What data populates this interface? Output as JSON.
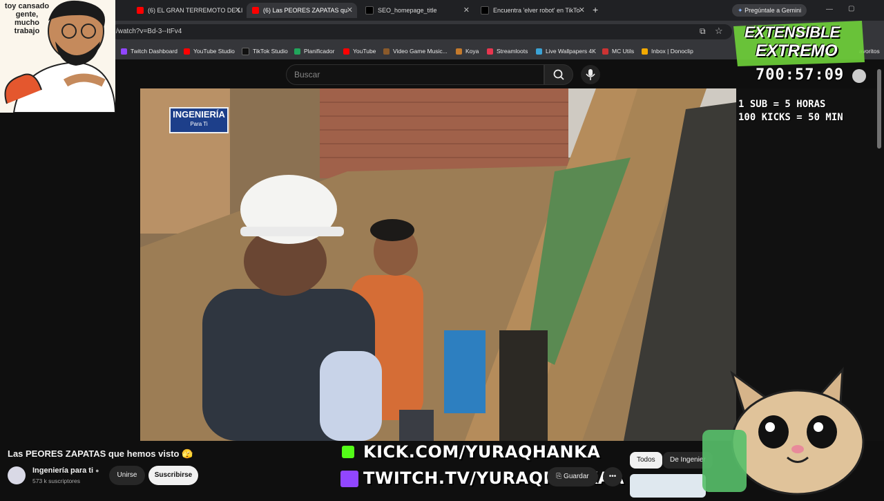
{
  "browser": {
    "tabs": [
      {
        "label": "(6) EL GRAN TERREMOTO DE LI",
        "favicon_color": "#ff0000"
      },
      {
        "label": "(6) Las PEORES ZAPATAS qu",
        "favicon_color": "#ff0000",
        "active": true
      },
      {
        "label": "SEO_homepage_title",
        "favicon_color": "#000000"
      },
      {
        "label": "Encuentra 'elver robot' en TikTo",
        "favicon_color": "#000000"
      }
    ],
    "new_tab": "+",
    "gemini_button": "Pregúntale a Gemini",
    "url": "/watch?v=Bd-3--ItFv4",
    "bookmarks": [
      {
        "label": "Twitch Dashboard",
        "color": "#9146ff"
      },
      {
        "label": "YouTube Studio",
        "color": "#ff0000"
      },
      {
        "label": "TikTok Studio",
        "color": "#111111"
      },
      {
        "label": "Planificador",
        "color": "#21a65b"
      },
      {
        "label": "YouTube",
        "color": "#ff0000"
      },
      {
        "label": "Video Game Music...",
        "color": "#8a5a2b"
      },
      {
        "label": "Koya",
        "color": "#c47a2c"
      },
      {
        "label": "Streamloots",
        "color": "#e8364f"
      },
      {
        "label": "Live Wallpapers 4K",
        "color": "#3ba3d6"
      },
      {
        "label": "MC Utils",
        "color": "#cc3333"
      },
      {
        "label": "Inbox | Donoclip",
        "color": "#f2a900"
      }
    ],
    "favorites_label": "avoritos"
  },
  "youtube": {
    "search_placeholder": "Buscar",
    "video_title": "Las PEORES ZAPATAS que hemos visto 🫣",
    "channel_name": "Ingeniería para ti",
    "subscribers": "573 k suscriptores",
    "join_label": "Unirse",
    "subscribe_label": "Suscribirse",
    "save_label": "Guardar",
    "chips": [
      "Todos",
      "De Ingenier"
    ],
    "video_logo_line1": "INGENIERÍA",
    "video_logo_line2": "Para Ti"
  },
  "overlay": {
    "webcam_caption": "toy cansado gente, mucho trabajo",
    "brand_line1": "EXTENSIBLE",
    "brand_line2": "EXTREMO",
    "timer": "700:57:09",
    "rule1": "1 SUB = 5 HORAS",
    "rule2": "100 KICKS = 50 MIN",
    "kick_url": "KICK.COM/YURAQHANKA",
    "twitch_url": "TWITCH.TV/YURAQHANKAA"
  }
}
